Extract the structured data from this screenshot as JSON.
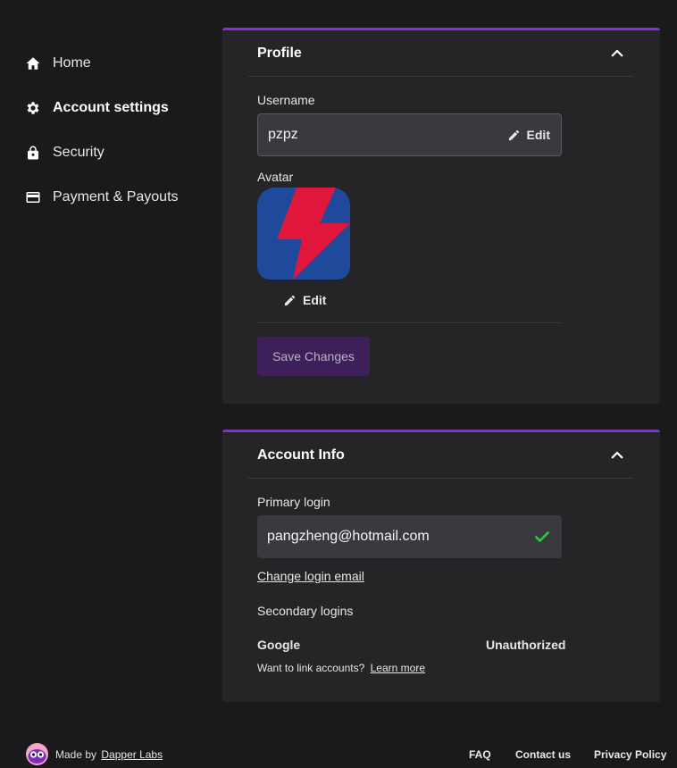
{
  "sidebar": {
    "items": [
      {
        "label": "Home",
        "icon": "home-icon"
      },
      {
        "label": "Account settings",
        "icon": "gear-icon",
        "active": true
      },
      {
        "label": "Security",
        "icon": "lock-icon"
      },
      {
        "label": "Payment & Payouts",
        "icon": "credit-card-icon"
      }
    ]
  },
  "profile": {
    "title": "Profile",
    "username_label": "Username",
    "username_value": "pzpz",
    "edit_label": "Edit",
    "avatar_label": "Avatar",
    "avatar_edit_label": "Edit",
    "save_label": "Save Changes"
  },
  "account_info": {
    "title": "Account Info",
    "primary_login_label": "Primary login",
    "primary_login_value": "pangzheng@hotmail.com",
    "change_login_link": "Change login email",
    "secondary_logins_label": "Secondary logins",
    "google_label": "Google",
    "google_status": "Unauthorized",
    "link_prompt": "Want to link accounts?",
    "learn_more": "Learn more"
  },
  "footer": {
    "made_by": "Made by",
    "made_by_link": "Dapper Labs",
    "faq": "FAQ",
    "contact": "Contact us",
    "privacy": "Privacy Policy"
  },
  "colors": {
    "accent": "#8a2be2",
    "background": "#1a1a1d",
    "card": "#252528",
    "check": "#2ecc40",
    "avatar_blue": "#1f4a9c",
    "avatar_red": "#e0163a"
  }
}
